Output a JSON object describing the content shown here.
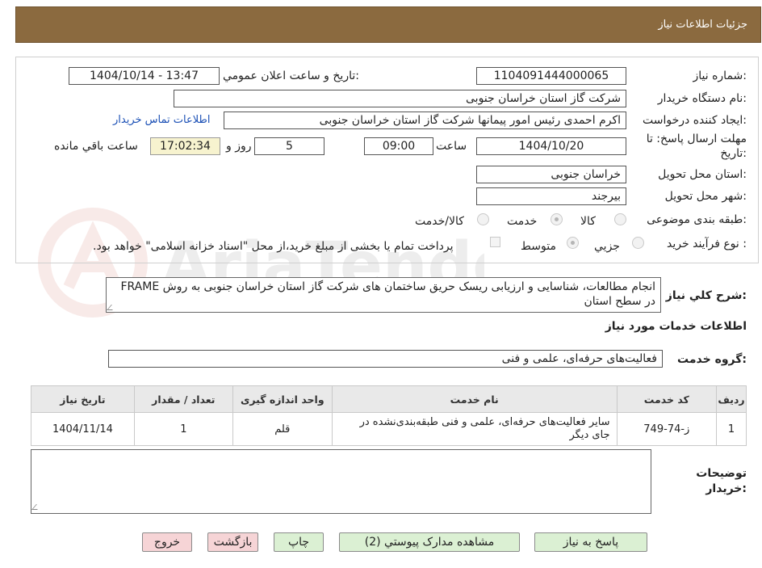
{
  "header": {
    "title": "جزئیات اطلاعات نیاز"
  },
  "form": {
    "need_number_label": "شماره نیاز:",
    "need_number": "1104091444000065",
    "announce_label": "تاریخ و ساعت اعلان عمومي:",
    "announce_value": "1404/10/14 - 13:47",
    "buyer_label": "نام دستگاه خريدار:",
    "buyer_value": "شرکت گاز استان خراسان جنوبی",
    "requester_label": "ایجاد کننده درخواست:",
    "requester_value": "اکرم احمدی رئیس امور پیمانها شرکت گاز استان خراسان جنوبی",
    "contact_link": "اطلاعات تماس خریدار",
    "deadline_label_1": "مهلت ارسال پاسخ: تا",
    "deadline_label_2": "تاريخ:",
    "deadline_date": "1404/10/20",
    "time_label": "ساعت",
    "deadline_time": "09:00",
    "days_value": "5",
    "days_label": "روز و",
    "remaining_time": "17:02:34",
    "remaining_label": "ساعت باقي مانده",
    "province_label": "استان محل تحویل:",
    "province_value": "خراسان جنوبی",
    "city_label": "شهر محل تحویل:",
    "city_value": "بیرجند",
    "category_label": "طبقه بندی موضوعی:",
    "category_options": [
      "کالا",
      "خدمت",
      "کالا/خدمت"
    ],
    "category_selected": "خدمت",
    "process_label": "نوع فرآیند خرید :",
    "process_options": [
      "جزیي",
      "متوسط"
    ],
    "process_selected": "متوسط",
    "payment_note": "پرداخت تمام یا بخشی از مبلغ خرید،از محل \"اسناد خزانه اسلامی\" خواهد بود."
  },
  "description": {
    "label": "شرح کلي نیاز:",
    "text": "انجام مطالعات، شناسایی و ارزیابی ریسک حریق ساختمان های شرکت گاز استان خراسان جنوبی به روش FRAME در سطح استان"
  },
  "services": {
    "section_title": "اطلاعات خدمات مورد نیاز",
    "group_label": "گروه خدمت:",
    "group_value": "فعالیت‌های حرفه‌ای، علمی و فنی",
    "table": {
      "headers": [
        "ردیف",
        "کد خدمت",
        "نام خدمت",
        "واحد اندازه گیری",
        "تعداد / مقدار",
        "تاریخ نیاز"
      ],
      "rows": [
        [
          "1",
          "ز-74-749",
          "سایر فعالیت‌های حرفه‌ای، علمی و فنی طبقه‌بندی‌نشده در جای دیگر",
          "قلم",
          "1",
          "1404/11/14"
        ]
      ]
    }
  },
  "buyer_notes": {
    "label_1": "توضیحات",
    "label_2": "خریدار:",
    "text": ""
  },
  "buttons": {
    "reply": "پاسخ به نیاز",
    "attachments": "مشاهده مدارک پیوستي (2)",
    "print": "چاپ",
    "back": "بازگشت",
    "exit": "خروج"
  },
  "colors": {
    "header_bg": "#8b6a3f",
    "time_box_bg": "#f7f3cf",
    "button_green": "#dbf0d3",
    "button_pink": "#f6d4d6"
  }
}
